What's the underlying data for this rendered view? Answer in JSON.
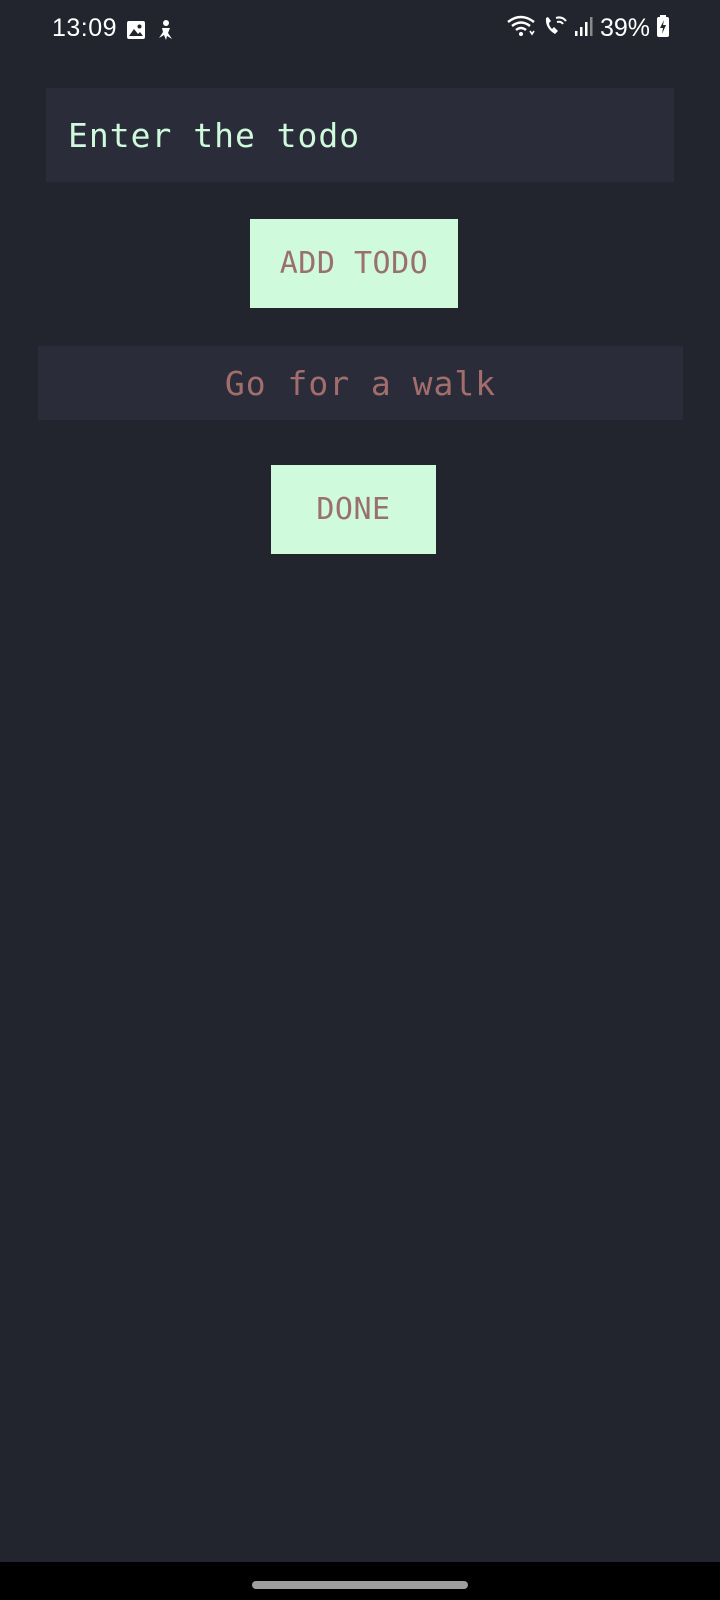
{
  "status_bar": {
    "time": "13:09",
    "battery": "39%",
    "left_icons": [
      "gallery-icon",
      "notification-figure-icon"
    ],
    "right_icons": [
      "wifi-icon",
      "wifi-calling-icon",
      "signal-icon",
      "battery-charging-icon"
    ]
  },
  "input": {
    "placeholder": "Enter the todo",
    "value": ""
  },
  "add_button": {
    "label": "ADD TODO"
  },
  "todos": [
    {
      "text": "Go for a walk"
    }
  ],
  "done_button": {
    "label": "DONE"
  },
  "colors": {
    "background": "#22252e",
    "surface": "#2a2d39",
    "accent": "#cffadb",
    "button_text": "#9b6f6f",
    "item_text": "#a46d6d"
  }
}
